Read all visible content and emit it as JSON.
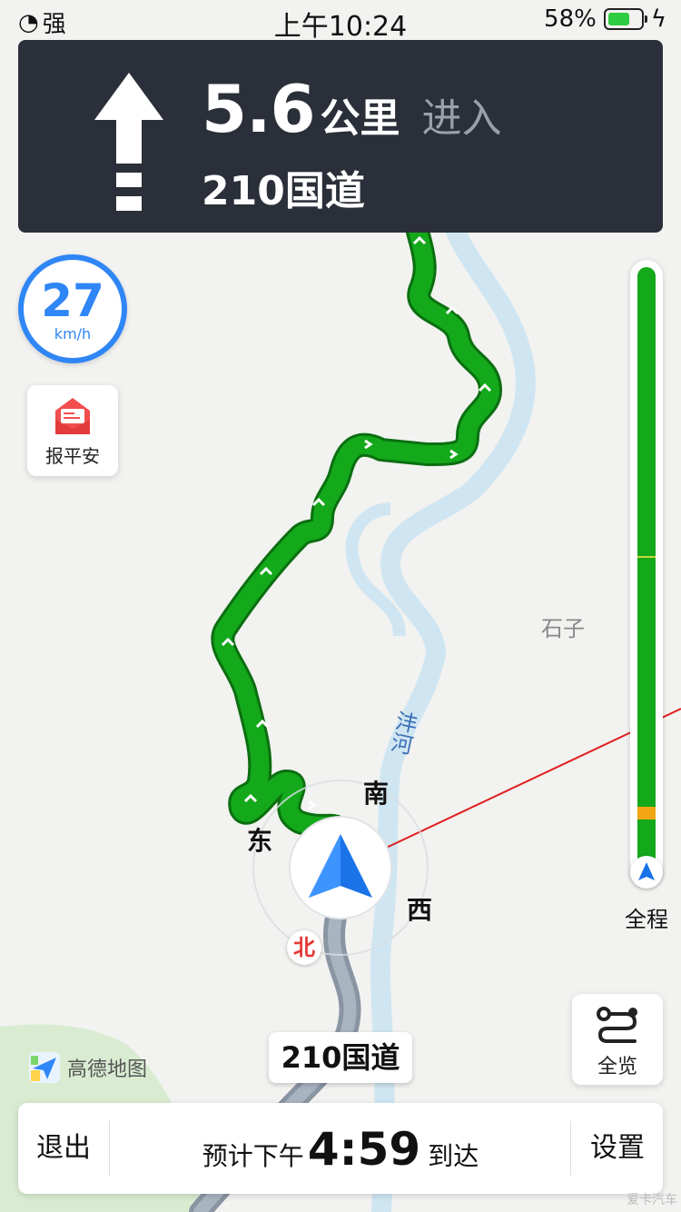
{
  "status": {
    "signal": "强",
    "time": "上午10:24",
    "battery": "58%"
  },
  "guidance": {
    "distance": "5.6",
    "unit": "公里",
    "action": "进入",
    "road": "210国道"
  },
  "speed": {
    "value": "27",
    "unit": "km/h"
  },
  "safety_button": {
    "label": "报平安"
  },
  "progress": {
    "label": "全程"
  },
  "overview_button": {
    "label": "全览"
  },
  "map": {
    "place_label": "石子",
    "river_label": "沣河",
    "compass": {
      "south": "南",
      "east": "东",
      "west": "西",
      "north": "北"
    },
    "current_road": "210国道",
    "route_color": "#14a81b",
    "river_color": "#cfe6f2"
  },
  "logo": {
    "text": "高德地图"
  },
  "bottom": {
    "exit": "退出",
    "eta_prefix": "预计下午",
    "eta_time": "4:59",
    "eta_suffix": "到达",
    "settings": "设置"
  },
  "watermark": "爱卡汽车"
}
